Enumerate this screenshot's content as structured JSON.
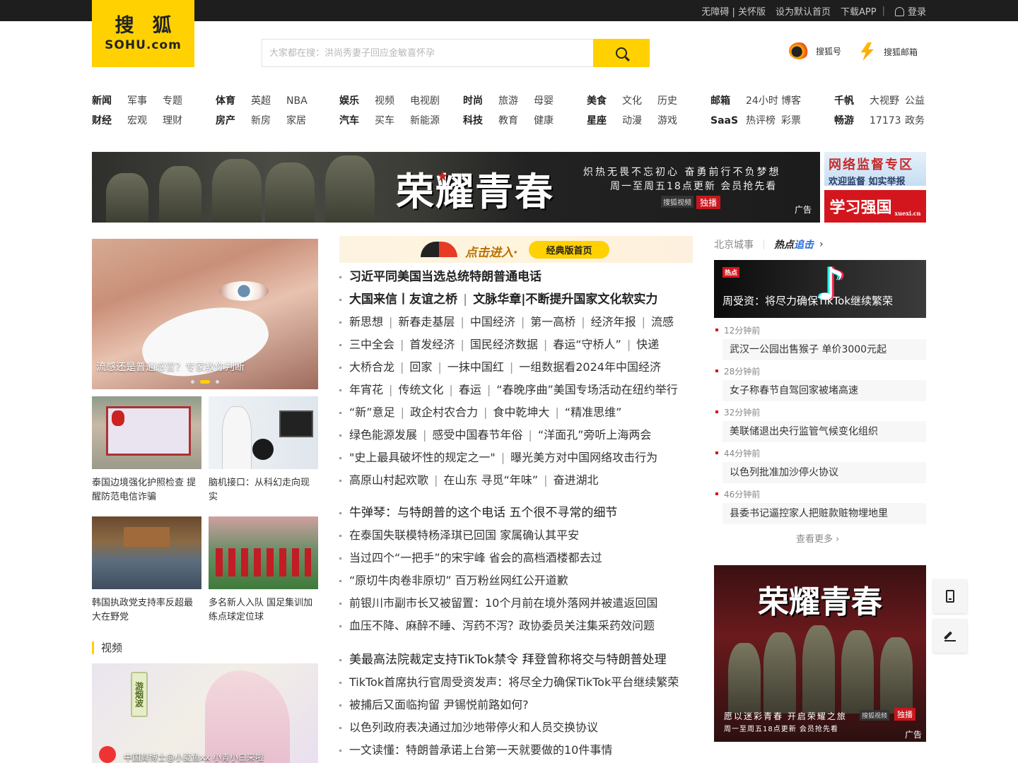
{
  "topbar": {
    "links": [
      "无障碍 | 关怀版",
      "设为默认首页",
      "下载APP"
    ],
    "login": "登录"
  },
  "logo": {
    "cn": "搜狐",
    "en": "SOHU.com"
  },
  "search": {
    "placeholder": "大家都在搜：洪尚秀妻子回应金敏喜怀孕"
  },
  "quick": {
    "sohuhao": "搜狐号",
    "mail": "搜狐邮箱"
  },
  "nav": [
    {
      "row1": [
        "新闻",
        "军事",
        "专题"
      ],
      "row2": [
        "财经",
        "宏观",
        "理财"
      ]
    },
    {
      "row1": [
        "体育",
        "英超",
        "NBA"
      ],
      "row2": [
        "房产",
        "新房",
        "家居"
      ]
    },
    {
      "row1": [
        "娱乐",
        "视频",
        "电视剧"
      ],
      "row2": [
        "汽车",
        "买车",
        "新能源"
      ]
    },
    {
      "row1": [
        "时尚",
        "旅游",
        "母婴"
      ],
      "row2": [
        "科技",
        "教育",
        "健康"
      ]
    },
    {
      "row1": [
        "美食",
        "文化",
        "历史"
      ],
      "row2": [
        "星座",
        "动漫",
        "游戏"
      ]
    },
    {
      "row1": [
        "邮箱",
        "24小时",
        "博客"
      ],
      "row2": [
        "SaaS",
        "热评榜",
        "彩票"
      ]
    },
    {
      "row1": [
        "千帆",
        "大视野",
        "公益"
      ],
      "row2": [
        "畅游",
        "17173",
        "政务"
      ]
    }
  ],
  "banner": {
    "title": "荣耀青春",
    "line1": "炽热无畏不忘初心 奋勇前行不负梦想",
    "line2": "周一至周五18点更新 会员抢先看",
    "tag1": "搜狐视频",
    "tag2": "独播",
    "ad": "广告"
  },
  "side_ads": {
    "jiandu_title": "网络监督专区",
    "jiandu_sub": "欢迎监督 如实举报",
    "xuexi": "学习强国",
    "xuexi_en": "xuexi.cn"
  },
  "hero": {
    "caption": "流感还是普通感冒？专家教你判断"
  },
  "thumbs": [
    {
      "caption": "泰国边境强化护照检查 提醒防范电信诈骗"
    },
    {
      "caption": "脑机接口：从科幻走向现实"
    },
    {
      "caption": "韩国执政党支持率反超最大在野党"
    },
    {
      "caption": "多名新人入队 国足集训加练点球定位球"
    }
  ],
  "video": {
    "section_title": "视频",
    "badge": "游烟波",
    "caption": "中国舞博士@小夏鱼xx 小青小白来啦"
  },
  "entry": {
    "go": "点击进入·",
    "classic": "经典版首页"
  },
  "lead_news": [
    [
      "习近平同美国当选总统特朗普通电话"
    ],
    [
      "大国来信丨友谊之桥",
      "文脉华章|不断提升国家文化软实力"
    ]
  ],
  "topic_news": [
    [
      "新思想",
      "新春走基层",
      "中国经济",
      "第一高桥",
      "经济年报",
      "流感"
    ],
    [
      "三中全会",
      "首发经济",
      "国民经济数据",
      "春运“守桥人”",
      "快递"
    ],
    [
      "大桥合龙",
      "回家",
      "一抹中国红",
      "一组数据看2024年中国经济"
    ],
    [
      "年宵花",
      "传统文化",
      "春运",
      "“春晚序曲”美国专场活动在纽约举行"
    ],
    [
      "“新”意足",
      "政企村农合力",
      "食中乾坤大",
      "“精准思维”"
    ],
    [
      "绿色能源发展",
      "感受中国春节年俗",
      "“洋面孔”旁听上海两会"
    ],
    [
      "\"史上最具破坏性的规定之一\"",
      "曝光美方对中国网络攻击行为"
    ],
    [
      "高原山村起欢歌",
      "在山东 寻觅“年味”",
      "奋进湖北"
    ]
  ],
  "news_group2": [
    "牛弹琴：与特朗普的这个电话 五个很不寻常的细节",
    "在泰国失联模特杨泽琪已回国 家属确认其平安",
    "当过四个“一把手”的宋宇峰 省会的高档酒楼都去过",
    "“原切牛肉卷非原切” 百万粉丝网红公开道歉",
    "前银川市副市长又被留置：10个月前在境外落网并被遣返回国",
    "血压不降、麻醉不睡、泻药不泻？政协委员关注集采药效问题"
  ],
  "news_group3": [
    "美最高法院裁定支持TikTok禁令 拜登曾称将交与特朗普处理",
    "TikTok首席执行官周受资发声：将尽全力确保TikTok平台继续繁荣",
    "被捕后又面临拘留 尹锡悦前路如何?",
    "以色列政府表决通过加沙地带停火和人员交换协议",
    "一文读懂：特朗普承诺上台第一天就要做的10件事情"
  ],
  "right": {
    "tab_city": "北京城事",
    "tab_hot1": "热点",
    "tab_hot2": "追击",
    "top_tag": "热点",
    "top_caption": "周受资：将尽力确保TikTok继续繁荣",
    "feed": [
      {
        "time": "12分钟前",
        "text": "武汉一公园出售猴子 单价3000元起"
      },
      {
        "time": "28分钟前",
        "text": "女子称春节自驾回家被堵高速"
      },
      {
        "time": "32分钟前",
        "text": "美联储退出央行监管气候变化组织"
      },
      {
        "time": "44分钟前",
        "text": "以色列批准加沙停火协议"
      },
      {
        "time": "46分钟前",
        "text": "县委书记逼控家人把赃款赃物埋地里"
      }
    ],
    "more": "查看更多",
    "ad": {
      "title": "荣耀青春",
      "line1": "愿以迷彩青春 开启荣耀之旅",
      "line2": "周一至周五18点更新 会员抢先看",
      "tag1": "搜狐视频",
      "tag2": "独播",
      "ad": "广告"
    }
  },
  "colors": {
    "brand": "#ffd100",
    "topbar": "#1e1e1e",
    "accent_red": "#d3161d"
  },
  "icons": [
    "search-icon",
    "user-icon",
    "sohuhao-icon",
    "mail-icon",
    "phone-icon",
    "edit-icon",
    "chevron-right-icon",
    "play-icon"
  ]
}
